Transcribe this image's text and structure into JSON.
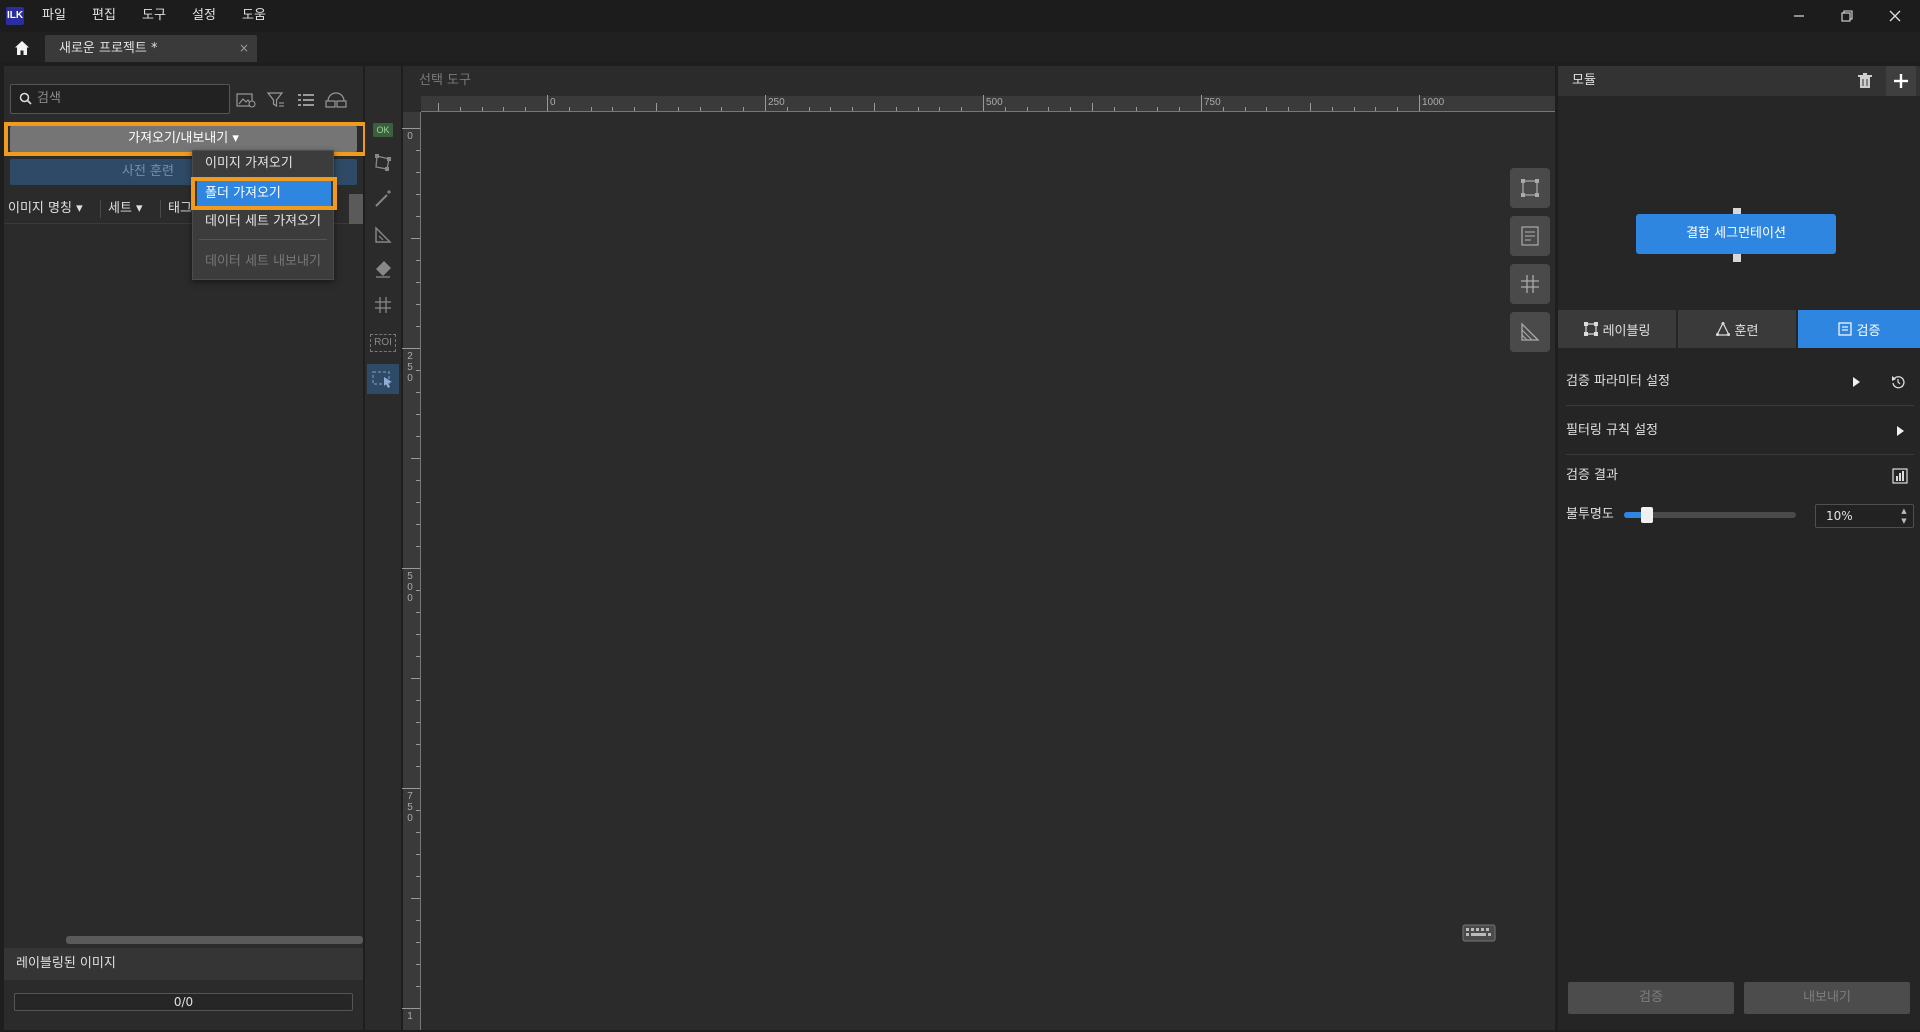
{
  "titlebar": {
    "logo": "ILK",
    "menu": [
      "파일",
      "편집",
      "도구",
      "설정",
      "도움"
    ]
  },
  "tabbar": {
    "project_tab": "새로운 프로젝트 *",
    "close": "×"
  },
  "left_panel": {
    "search_placeholder": "검색",
    "import_export_label": "가져오기/내보내기 ▾",
    "pretrain_label": "사전 훈련",
    "columns": [
      "이미지 명칭 ▾",
      "세트 ▾",
      "태그"
    ],
    "labeled_images_title": "레이블링된 이미지",
    "progress_text": "0/0"
  },
  "dropdown": {
    "items": [
      "이미지 가져오기",
      "폴더 가져오기",
      "데이터 세트 가져오기",
      "데이터 세트 내보내기"
    ]
  },
  "tool_strip": {
    "ok_label": "OK",
    "roi_label": "ROI"
  },
  "canvas": {
    "title": "선택 도구",
    "h_ruler_labels": [
      "0",
      "250",
      "500",
      "750",
      "1000"
    ],
    "v_ruler_labels": [
      "0",
      "250",
      "500",
      "750",
      "1"
    ]
  },
  "right_panel": {
    "module_title": "모듈",
    "node_label": "결함 세그먼테이션",
    "tabs": [
      "레이블링",
      "훈련",
      "검증"
    ],
    "active_tab": "검증",
    "settings": {
      "param_label": "검증 파라미터 설정",
      "filter_label": "필터링 규칙 설정",
      "result_label": "검증 결과",
      "opacity_label": "불투명도",
      "opacity_value": "10%",
      "opacity_fraction": 0.1
    },
    "buttons": {
      "verify": "검증",
      "export": "내보내기"
    }
  },
  "colors": {
    "accent_blue": "#2e86e0",
    "highlight_orange": "#f09a1e"
  }
}
